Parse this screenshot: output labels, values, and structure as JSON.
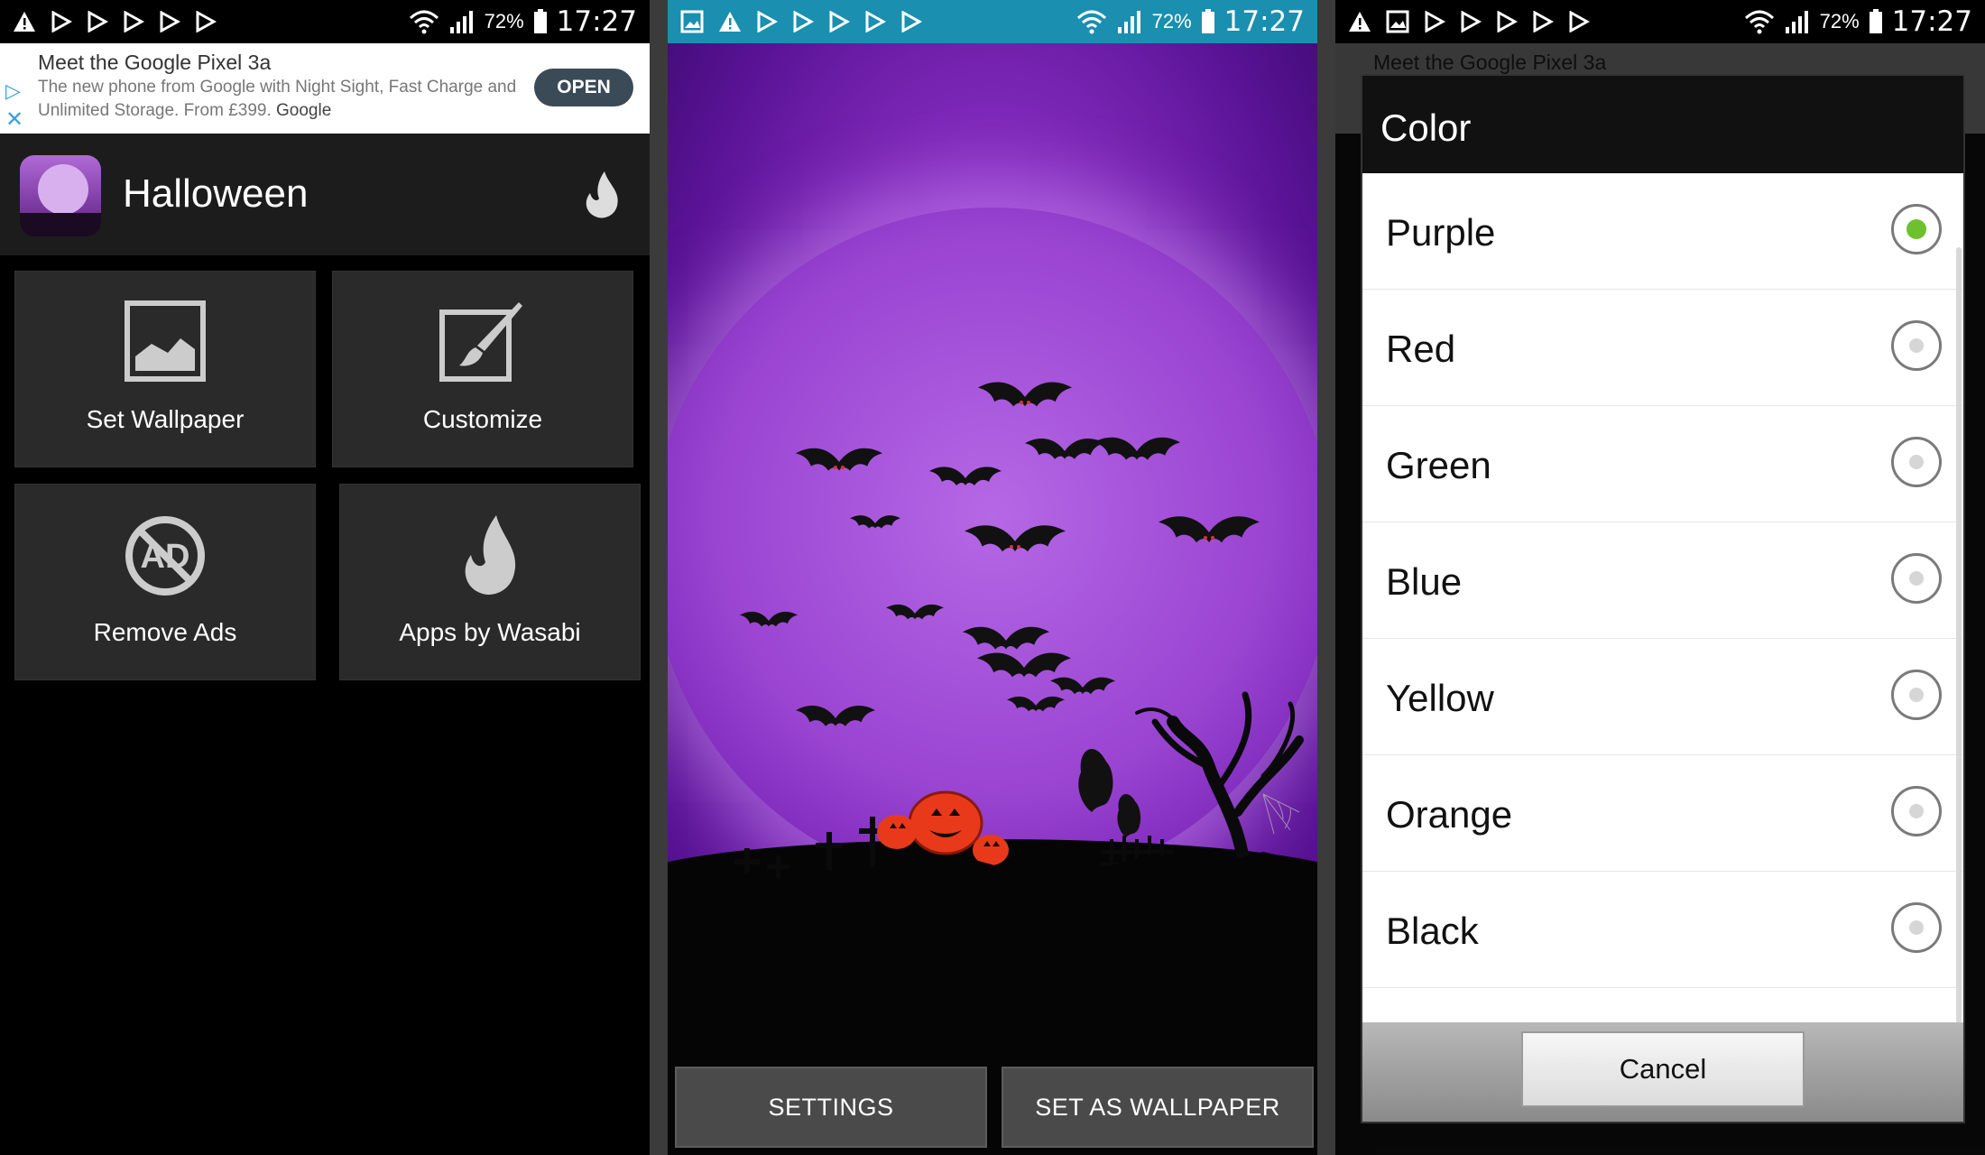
{
  "status": {
    "time": "17:27",
    "battery": "72%"
  },
  "ad": {
    "title": "Meet the Google Pixel 3a",
    "body": "The new phone from Google with Night Sight, Fast Charge and Unlimited Storage. From £399.",
    "brand": "Google",
    "open_label": "OPEN"
  },
  "app": {
    "title": "Halloween",
    "tiles": [
      {
        "label": "Set Wallpaper",
        "icon": "picture-icon"
      },
      {
        "label": "Customize",
        "icon": "paintbrush-icon"
      },
      {
        "label": "Remove Ads",
        "icon": "no-ads-icon"
      },
      {
        "label": "Apps by Wasabi",
        "icon": "flame-icon"
      }
    ]
  },
  "preview": {
    "settings_label": "SETTINGS",
    "set_wallpaper_label": "SET AS WALLPAPER"
  },
  "color_dialog": {
    "title": "Color",
    "options": [
      "Purple",
      "Red",
      "Green",
      "Blue",
      "Yellow",
      "Orange",
      "Black"
    ],
    "selected": "Purple",
    "cancel_label": "Cancel"
  },
  "colors": {
    "status_teal": "#1a8fb0",
    "radio_selected": "#6ec12e",
    "moon_purple": "#9a44d2"
  }
}
